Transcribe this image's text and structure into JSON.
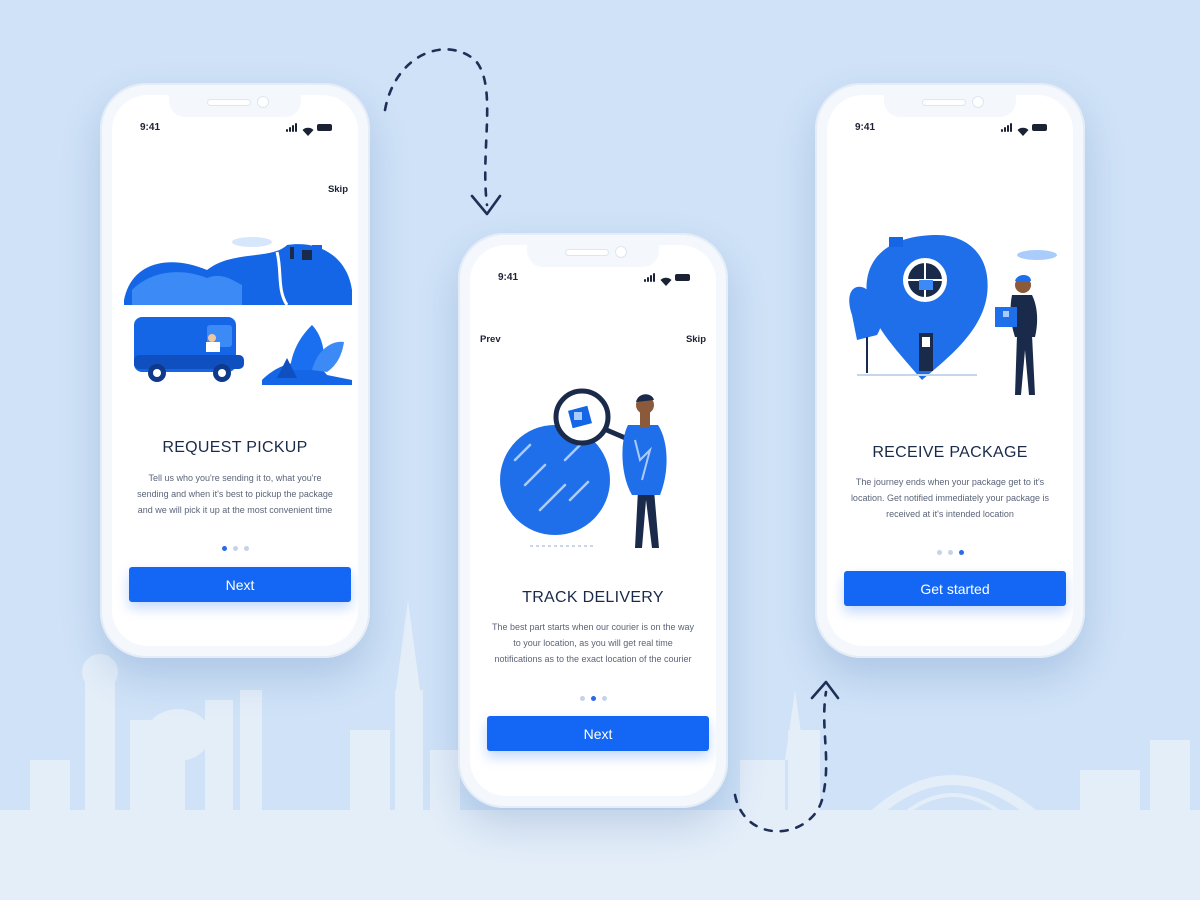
{
  "colors": {
    "accent": "#1467f5",
    "background": "#cfe2f7",
    "title": "#1a2a4a"
  },
  "screens": [
    {
      "time": "9:41",
      "skip": "Skip",
      "illustration": "delivery-van-hills",
      "title": "REQUEST PICKUP",
      "description": "Tell us who you're sending it to, what you're sending and when it's best to pickup the package and we will pick it up at the most convenient time",
      "active_dot": 1,
      "button": "Next"
    },
    {
      "time": "9:41",
      "prev": "Prev",
      "skip": "Skip",
      "illustration": "courier-magnifying-glass",
      "title": "TRACK DELIVERY",
      "description": "The best part starts when our courier is on the way to your location, as you will get real time notifications as to the exact location of the courier",
      "active_dot": 2,
      "button": "Next"
    },
    {
      "time": "9:41",
      "illustration": "courier-location-pin",
      "title": "RECEIVE PACKAGE",
      "description": "The journey ends when your package get to it's location. Get notified immediately your package is received at it's intended location",
      "active_dot": 3,
      "button": "Get started"
    }
  ]
}
